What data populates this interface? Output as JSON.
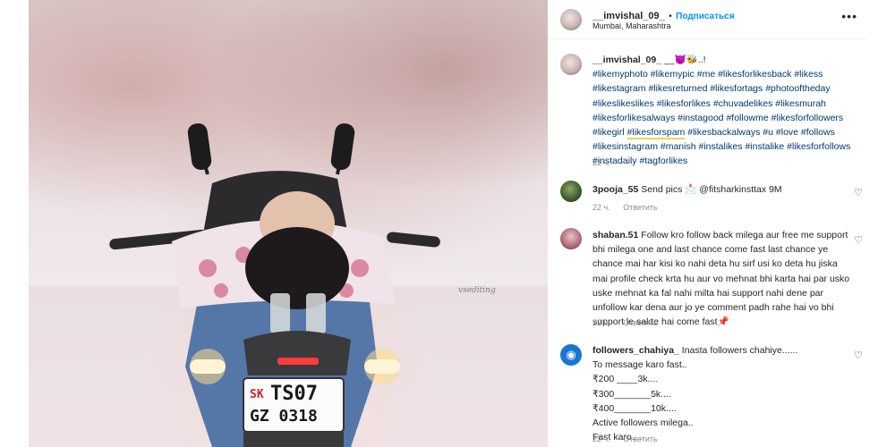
{
  "post": {
    "username": "__imvishal_09_",
    "subscribe_label": "Подписаться",
    "separator": "•",
    "location": "Mumbai, Maharashtra",
    "more_label": "•••"
  },
  "photo": {
    "plate_line1_left": "SK",
    "plate_line1": "TS07",
    "plate_line2": "GZ 0318",
    "watermark": "vsediting"
  },
  "caption": {
    "username": "__imvishal_09_",
    "emoji": "__😈🐝..!",
    "tags": [
      "#likemyphoto",
      "#likemypic",
      "#me",
      "#likesforlikesback",
      "#likess",
      "#likestagram",
      "#likesreturned",
      "#likesfortags",
      "#photooftheday",
      "#likeslikeslikes",
      "#likesforlikes",
      "#chuvadelikes",
      "#likesmurah",
      "#likesforlikesalways",
      "#instagood",
      "#followme",
      "#likesforfollowers",
      "#likegirl",
      "#likesforspam",
      "#likesbackalways",
      "#u",
      "#love",
      "#follows",
      "#likesinstagram",
      "#manish",
      "#instalikes",
      "#instalike",
      "#likesforfollows",
      "#instadaily",
      "#tagforlikes"
    ],
    "time": "22 ч."
  },
  "comments": [
    {
      "username": "3pooja_55",
      "text": "Send pics 📩 @fitsharkinsttax 9M",
      "time": "22 ч.",
      "reply": "Ответить"
    },
    {
      "username": "shaban.51",
      "text": "Follow kro follow back milega aur free me support bhi milega one and last chance come fast last chance ye chance mai har kisi ko nahi deta hu sirf usi ko deta hu jiska mai profile check krta hu aur vo mehnat bhi karta hai par usko uske mehnat ka fal nahi milta hai support nahi dene par unfollow kar dena aur jo ye comment padh rahe hai vo bhi support le sakte hai come fast📌",
      "time": "22 ч.",
      "reply": "Ответить"
    },
    {
      "username": "followers_chahiya_",
      "lines": [
        "Inasta followers chahiye......",
        "To message karo fast..",
        "₹200 ____3k....",
        "₹300_______5k....",
        "₹400_______10k....",
        "Active followers milega..",
        "Fast karo....."
      ],
      "time": "22 ч.",
      "reply": "Ответить"
    }
  ],
  "icons": {
    "heart": "heart-icon",
    "more": "more-options-icon",
    "avatar_badge": "chat-bubble-icon"
  },
  "colors": {
    "link": "#0095f6",
    "hashtag": "#00376b",
    "muted": "#8e8e8e"
  }
}
